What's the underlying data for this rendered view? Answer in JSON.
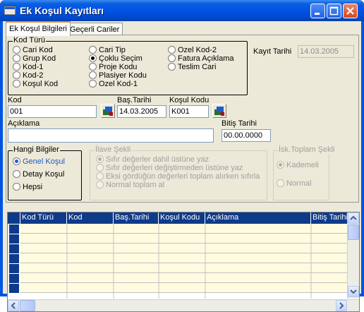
{
  "window": {
    "title": "Ek Koşul Kayıtları"
  },
  "tabs": [
    {
      "label": "Ek Koşul Bilgileri",
      "active": true
    },
    {
      "label": "Geçerli Cariler",
      "active": false
    }
  ],
  "kod_turu": {
    "label": "Kod Türü",
    "col1": [
      "Cari Kod",
      "Grup Kod",
      "Kod-1",
      "Kod-2",
      "Koşul Kod"
    ],
    "col2": [
      "Cari Tip",
      "Çoklu Seçim",
      "Proje Kodu",
      "Plasiyer Kodu",
      "Ozel Kod-1"
    ],
    "col3": [
      "Ozel Kod-2",
      "Fatura Açıklama",
      "Teslim Cari"
    ],
    "selected": "Çoklu Seçim"
  },
  "kayit_tarihi": {
    "label": "Kayıt Tarihi",
    "value": "14.03.2005"
  },
  "kod": {
    "label": "Kod",
    "value": "001"
  },
  "bas_tarihi": {
    "label": "Baş.Tarihi",
    "value": "14.03.2005"
  },
  "kosul_kodu": {
    "label": "Koşul Kodu",
    "value": "K001"
  },
  "aciklama": {
    "label": "Açıklama",
    "value": ""
  },
  "bitis_tarihi": {
    "label": "Bitiş Tarihi",
    "value": "00.00.0000"
  },
  "hangi_bilgiler": {
    "label": "Hangi Bilgiler",
    "options": [
      "Genel Koşul",
      "Detay Koşul",
      "Hepsi"
    ],
    "selected": "Genel Koşul"
  },
  "ilave_sekli": {
    "label": "İlave Şekli",
    "options": [
      "Sıfır değerler dahil üstüne yaz",
      "Sıfır değerleri değiştirmeden üstüne yaz",
      "Eksi gördüğün değerleri toplam alırken sıfırla",
      "Normal toplam al"
    ]
  },
  "isk_toplam": {
    "label": "İsk.Toplam Şekli",
    "options": [
      "Kademeli",
      "Normal"
    ],
    "selected": "Kademeli"
  },
  "grid": {
    "columns": [
      "Kod Türü",
      "Kod",
      "Baş.Tarihi",
      "Koşul Kodu",
      "Açıklama",
      "Bitiş Tarihi"
    ]
  },
  "colors": {
    "titlebar": "#0054e3",
    "grid_header": "#0e3a8a",
    "grid_row_alt": "#fffbe0"
  }
}
